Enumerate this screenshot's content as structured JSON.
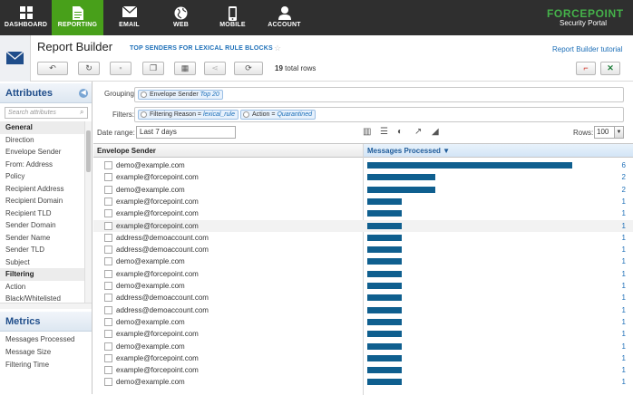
{
  "nav": {
    "items": [
      {
        "label": "DASHBOARD",
        "icon": "dashboard-icon"
      },
      {
        "label": "REPORTING",
        "icon": "reporting-icon"
      },
      {
        "label": "EMAIL",
        "icon": "email-icon"
      },
      {
        "label": "WEB",
        "icon": "web-icon"
      },
      {
        "label": "MOBILE",
        "icon": "mobile-icon"
      },
      {
        "label": "ACCOUNT",
        "icon": "account-icon"
      }
    ],
    "active_index": 1,
    "brand": "FORCEPOINT",
    "brand_sub": "Security Portal"
  },
  "header": {
    "title": "Report Builder",
    "subtitle": "TOP SENDERS FOR LEXICAL RULE BLOCKS",
    "tutorial_link": "Report Builder tutorial",
    "row_count": "19",
    "row_count_suffix": "total rows"
  },
  "sidebar": {
    "attributes_title": "Attributes",
    "search_placeholder": "Search attributes",
    "groups": [
      {
        "name": "General",
        "items": [
          "Direction",
          "Envelope Sender",
          "From: Address",
          "Policy",
          "Recipient Address",
          "Recipient Domain",
          "Recipient TLD",
          "Sender Domain",
          "Sender Name",
          "Sender TLD",
          "Subject"
        ]
      },
      {
        "name": "Filtering",
        "items": [
          "Action",
          "Black/Whitelisted"
        ]
      }
    ],
    "metrics_title": "Metrics",
    "metrics": [
      "Messages Processed",
      "Message Size",
      "Filtering Time"
    ]
  },
  "filters": {
    "grouping_label": "Grouping:",
    "grouping_chip": {
      "name": "Envelope Sender",
      "value": "Top 20"
    },
    "filters_label": "Filters:",
    "filter_chips": [
      {
        "name": "Filtering Reason",
        "value": "lexical_rule"
      },
      {
        "name": "Action",
        "value": "Quarantined"
      }
    ],
    "date_label": "Date range:",
    "date_value": "Last 7 days",
    "rows_label": "Rows:",
    "rows_value": "100"
  },
  "grid": {
    "col_sender": "Envelope Sender",
    "col_messages": "Messages Processed",
    "rows": [
      {
        "sender": "demo@example.com",
        "count": 6
      },
      {
        "sender": "example@forcepoint.com",
        "count": 2
      },
      {
        "sender": "demo@example.com",
        "count": 2
      },
      {
        "sender": "example@forcepoint.com",
        "count": 1
      },
      {
        "sender": "example@forcepoint.com",
        "count": 1
      },
      {
        "sender": "example@forcepoint.com",
        "count": 1
      },
      {
        "sender": "address@demoaccount.com",
        "count": 1
      },
      {
        "sender": "address@demoaccount.com",
        "count": 1
      },
      {
        "sender": "demo@example.com",
        "count": 1
      },
      {
        "sender": "example@forcepoint.com",
        "count": 1
      },
      {
        "sender": "demo@example.com",
        "count": 1
      },
      {
        "sender": "address@demoaccount.com",
        "count": 1
      },
      {
        "sender": "address@demoaccount.com",
        "count": 1
      },
      {
        "sender": "demo@example.com",
        "count": 1
      },
      {
        "sender": "example@forcepoint.com",
        "count": 1
      },
      {
        "sender": "demo@example.com",
        "count": 1
      },
      {
        "sender": "example@forcepoint.com",
        "count": 1
      },
      {
        "sender": "example@forcepoint.com",
        "count": 1
      },
      {
        "sender": "demo@example.com",
        "count": 1
      }
    ],
    "highlight_row": 5,
    "bar_color": "#0f5f8f"
  },
  "colors": {
    "nav_bg": "#2f2f2f",
    "active": "#48a01a",
    "link": "#1d6fb8",
    "brand": "#45b24a"
  }
}
